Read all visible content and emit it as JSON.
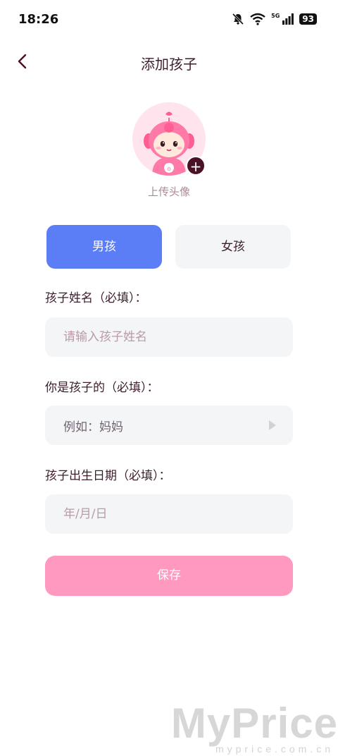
{
  "status_bar": {
    "time": "18:26",
    "network": "5G",
    "battery": "93",
    "icons": [
      "bell-off-icon",
      "wifi-icon",
      "signal-icon",
      "battery-icon"
    ]
  },
  "nav": {
    "title": "添加孩子",
    "back_icon": "chevron-left-icon"
  },
  "avatar": {
    "upload_label": "上传头像",
    "add_symbol": "+"
  },
  "gender": {
    "boy_label": "男孩",
    "girl_label": "女孩",
    "selected": "男孩",
    "selected_color": "#5b7df5"
  },
  "form": {
    "name_label": "孩子姓名（必填）：",
    "name_placeholder": "请输入孩子姓名",
    "relation_label": "你是孩子的（必填）：",
    "relation_placeholder": "例如：妈妈",
    "birthday_label": "孩子出生日期（必填）：",
    "birthday_placeholder": "年/月/日"
  },
  "save_label": "保存",
  "save_color": "#ff99bf",
  "watermark": {
    "brand": "MyPrice",
    "domain": "myprice.com.cn"
  }
}
